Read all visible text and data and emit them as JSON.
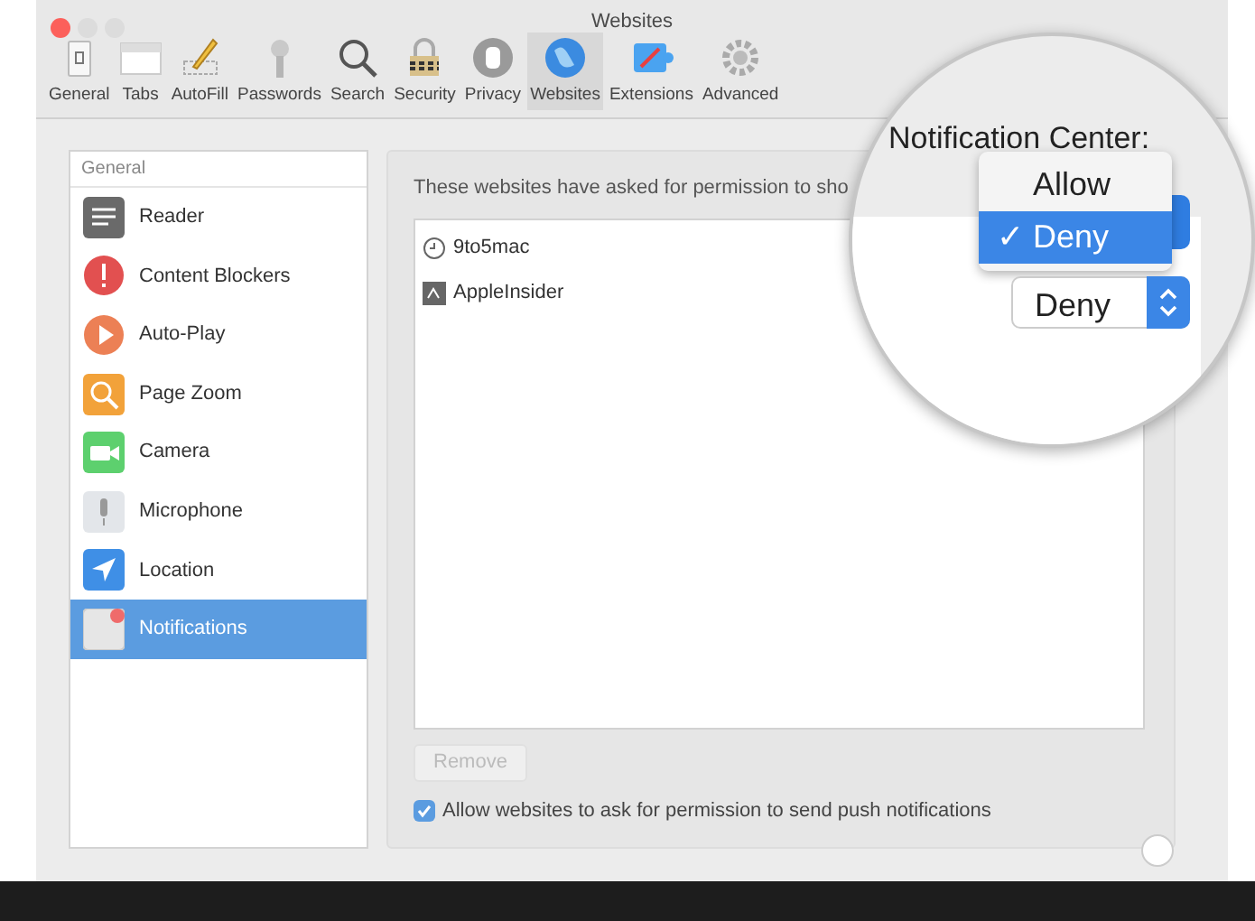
{
  "window": {
    "title": "Websites"
  },
  "toolbar": [
    {
      "label": "General",
      "selected": false
    },
    {
      "label": "Tabs",
      "selected": false
    },
    {
      "label": "AutoFill",
      "selected": false
    },
    {
      "label": "Passwords",
      "selected": false
    },
    {
      "label": "Search",
      "selected": false
    },
    {
      "label": "Security",
      "selected": false
    },
    {
      "label": "Privacy",
      "selected": false
    },
    {
      "label": "Websites",
      "selected": true
    },
    {
      "label": "Extensions",
      "selected": false
    },
    {
      "label": "Advanced",
      "selected": false
    }
  ],
  "sidebar": {
    "heading": "General",
    "items": [
      {
        "label": "Reader",
        "selected": false
      },
      {
        "label": "Content Blockers",
        "selected": false
      },
      {
        "label": "Auto-Play",
        "selected": false
      },
      {
        "label": "Page Zoom",
        "selected": false
      },
      {
        "label": "Camera",
        "selected": false
      },
      {
        "label": "Microphone",
        "selected": false
      },
      {
        "label": "Location",
        "selected": false
      },
      {
        "label": "Notifications",
        "selected": true
      }
    ]
  },
  "panel": {
    "description": "These websites have asked for permission to sho",
    "sites": [
      {
        "name": "9to5mac",
        "kind": "clock"
      },
      {
        "name": "AppleInsider",
        "kind": "logo"
      }
    ],
    "remove_button": {
      "label": "Remove",
      "disabled": true
    },
    "allow_checkbox": {
      "label": "Allow websites to ask for permission to send push notifications",
      "checked": true
    }
  },
  "magnifier": {
    "heading": "Notification Center:",
    "menu": [
      {
        "label": "Allow",
        "selected": false
      },
      {
        "label": "Deny",
        "selected": true,
        "mark": "✓"
      }
    ],
    "select": {
      "value": "Deny"
    }
  }
}
